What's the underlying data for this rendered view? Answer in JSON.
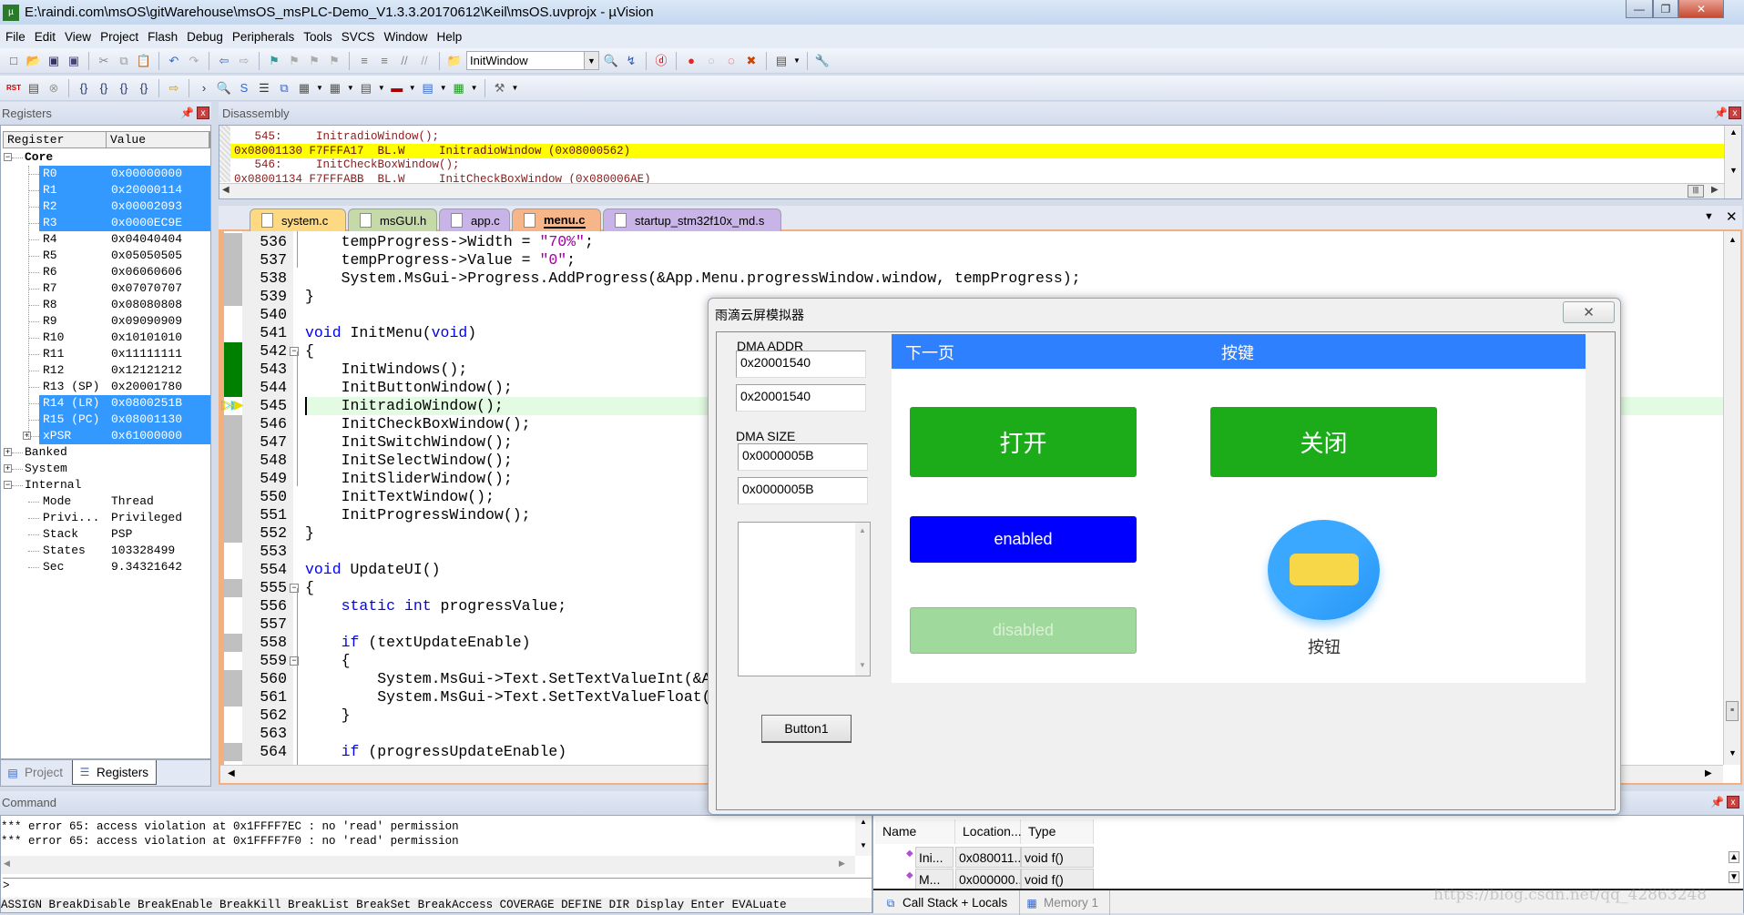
{
  "window": {
    "title": "E:\\raindi.com\\msOS\\gitWarehouse\\msOS_msPLC-Demo_V1.3.3.20170612\\Keil\\msOS.uvprojx - µVision"
  },
  "menu": [
    "File",
    "Edit",
    "View",
    "Project",
    "Flash",
    "Debug",
    "Peripherals",
    "Tools",
    "SVCS",
    "Window",
    "Help"
  ],
  "toolbar1": {
    "icons_before_combo": [
      "new-file",
      "open",
      "save",
      "save-all",
      "|",
      "cut",
      "copy",
      "paste",
      "|",
      "undo",
      "redo",
      "|",
      "nav-back",
      "nav-forward",
      "|",
      "bookmark",
      "prev-bookmark",
      "next-bookmark",
      "clear-bookmarks",
      "|",
      "indent",
      "unindent",
      "comment",
      "uncomment",
      "|",
      "find-in-files"
    ],
    "combo_value": "InitWindow",
    "icons_after_combo": [
      "find",
      "incremental-find",
      "|",
      "debug-session",
      "|",
      "insert-breakpoint",
      "enable-breakpoint",
      "disable-breakpoints",
      "kill-breakpoints",
      "|",
      "window-layout",
      "|",
      "configure"
    ]
  },
  "toolbar2": {
    "icons": [
      "reset",
      "run",
      "stop",
      "|",
      "step",
      "step-over",
      "step-out",
      "run-to-cursor",
      "|",
      "show-next-statement",
      "|",
      "command-window",
      "disassembly-window",
      "symbols-window",
      "registers-window",
      "call-stack-window",
      "watch-window",
      "memory-window",
      "serial-window",
      "analysis-window",
      "trace-window",
      "system-viewer",
      "|",
      "toolbox"
    ]
  },
  "registers": {
    "title": "Registers",
    "col_register": "Register",
    "col_value": "Value",
    "rows": [
      {
        "name": "Core",
        "value": "",
        "level": 0,
        "expander": "minus",
        "bold": true
      },
      {
        "name": "R0",
        "value": "0x00000000",
        "level": 1,
        "selected": true
      },
      {
        "name": "R1",
        "value": "0x20000114",
        "level": 1,
        "selected": true
      },
      {
        "name": "R2",
        "value": "0x00002093",
        "level": 1,
        "selected": true
      },
      {
        "name": "R3",
        "value": "0x0000EC9E",
        "level": 1,
        "selected": true
      },
      {
        "name": "R4",
        "value": "0x04040404",
        "level": 1
      },
      {
        "name": "R5",
        "value": "0x05050505",
        "level": 1
      },
      {
        "name": "R6",
        "value": "0x06060606",
        "level": 1
      },
      {
        "name": "R7",
        "value": "0x07070707",
        "level": 1
      },
      {
        "name": "R8",
        "value": "0x08080808",
        "level": 1
      },
      {
        "name": "R9",
        "value": "0x09090909",
        "level": 1
      },
      {
        "name": "R10",
        "value": "0x10101010",
        "level": 1
      },
      {
        "name": "R11",
        "value": "0x11111111",
        "level": 1
      },
      {
        "name": "R12",
        "value": "0x12121212",
        "level": 1
      },
      {
        "name": "R13 (SP)",
        "value": "0x20001780",
        "level": 1
      },
      {
        "name": "R14 (LR)",
        "value": "0x0800251B",
        "level": 1,
        "selected": true
      },
      {
        "name": "R15 (PC)",
        "value": "0x08001130",
        "level": 1,
        "selected": true
      },
      {
        "name": "xPSR",
        "value": "0x61000000",
        "level": 1,
        "selected": true,
        "expander": "plus"
      },
      {
        "name": "Banked",
        "value": "",
        "level": 0,
        "expander": "plus"
      },
      {
        "name": "System",
        "value": "",
        "level": 0,
        "expander": "plus"
      },
      {
        "name": "Internal",
        "value": "",
        "level": 0,
        "expander": "minus"
      },
      {
        "name": "Mode",
        "value": "Thread",
        "level": 1
      },
      {
        "name": "Privi...",
        "value": "Privileged",
        "level": 1
      },
      {
        "name": "Stack",
        "value": "PSP",
        "level": 1
      },
      {
        "name": "States",
        "value": "103328499",
        "level": 1
      },
      {
        "name": "Sec",
        "value": "9.34321642",
        "level": 1
      }
    ],
    "tabs": [
      {
        "label": "Project",
        "active": false
      },
      {
        "label": "Registers",
        "active": true
      }
    ]
  },
  "disassembly": {
    "title": "Disassembly",
    "lines": [
      {
        "text": "   545:     InitradioWindow();",
        "current": false
      },
      {
        "text": "0x08001130 F7FFFA17  BL.W     InitradioWindow (0x08000562)",
        "current": true
      },
      {
        "text": "   546:     InitCheckBoxWindow();",
        "current": false
      },
      {
        "text": "0x08001134 F7FFFABB  BL.W     InitCheckBoxWindow (0x080006AE)",
        "current": false
      }
    ]
  },
  "file_tabs": [
    {
      "label": "system.c",
      "color": "#fcd982",
      "active": false
    },
    {
      "label": "msGUI.h",
      "color": "#c6d9a8",
      "active": false
    },
    {
      "label": "app.c",
      "color": "#c8b4e6",
      "active": false
    },
    {
      "label": "menu.c",
      "color": "#f7b68a",
      "active": true
    },
    {
      "label": "startup_stm32f10x_md.s",
      "color": "#c8b4e6",
      "active": false
    }
  ],
  "code": {
    "current_line": 545,
    "lines": [
      {
        "n": "536",
        "m": "gray",
        "tok": [
          [
            "    tempProgress->Width = ",
            ""
          ],
          [
            "\"70%\"",
            "str"
          ],
          [
            ";",
            ""
          ]
        ]
      },
      {
        "n": "537",
        "m": "gray",
        "tok": [
          [
            "    tempProgress->Value = ",
            ""
          ],
          [
            "\"0\"",
            "str"
          ],
          [
            ";",
            ""
          ]
        ]
      },
      {
        "n": "538",
        "m": "gray",
        "tok": [
          [
            "    System.MsGui->Progress.AddProgress(&App.Menu.progressWindow.window, tempProgress);",
            ""
          ]
        ]
      },
      {
        "n": "539",
        "m": "gray",
        "tok": [
          [
            "}",
            ""
          ]
        ]
      },
      {
        "n": "540",
        "m": "",
        "tok": []
      },
      {
        "n": "541",
        "m": "",
        "tok": [
          [
            "void",
            "kw"
          ],
          [
            " InitMenu(",
            ""
          ],
          [
            "void",
            "kw"
          ],
          [
            ")",
            ""
          ]
        ]
      },
      {
        "n": "542",
        "m": "green",
        "fold": true,
        "tok": [
          [
            "{",
            ""
          ]
        ]
      },
      {
        "n": "543",
        "m": "green",
        "tok": [
          [
            "    InitWindows();",
            ""
          ]
        ]
      },
      {
        "n": "544",
        "m": "green",
        "tok": [
          [
            "    InitButtonWindow();",
            ""
          ]
        ]
      },
      {
        "n": "545",
        "m": "arrow",
        "tok": [
          [
            "    InitradioWindow();",
            ""
          ]
        ]
      },
      {
        "n": "546",
        "m": "gray",
        "tok": [
          [
            "    InitCheckBoxWindow();",
            ""
          ]
        ]
      },
      {
        "n": "547",
        "m": "gray",
        "tok": [
          [
            "    InitSwitchWindow();",
            ""
          ]
        ]
      },
      {
        "n": "548",
        "m": "gray",
        "tok": [
          [
            "    InitSelectWindow();",
            ""
          ]
        ]
      },
      {
        "n": "549",
        "m": "gray",
        "tok": [
          [
            "    InitSliderWindow();",
            ""
          ]
        ]
      },
      {
        "n": "550",
        "m": "gray",
        "tok": [
          [
            "    InitTextWindow();",
            ""
          ]
        ]
      },
      {
        "n": "551",
        "m": "gray",
        "tok": [
          [
            "    InitProgressWindow();",
            ""
          ]
        ]
      },
      {
        "n": "552",
        "m": "gray",
        "tok": [
          [
            "}",
            ""
          ]
        ]
      },
      {
        "n": "553",
        "m": "",
        "tok": []
      },
      {
        "n": "554",
        "m": "",
        "tok": [
          [
            "void",
            "kw"
          ],
          [
            " UpdateUI()",
            ""
          ]
        ]
      },
      {
        "n": "555",
        "m": "gray",
        "fold": true,
        "tok": [
          [
            "{",
            ""
          ]
        ]
      },
      {
        "n": "556",
        "m": "",
        "tok": [
          [
            "    ",
            ""
          ],
          [
            "static",
            "kw"
          ],
          [
            " ",
            ""
          ],
          [
            "int",
            "kw"
          ],
          [
            " progressValue;",
            ""
          ]
        ]
      },
      {
        "n": "557",
        "m": "",
        "tok": []
      },
      {
        "n": "558",
        "m": "gray",
        "tok": [
          [
            "    ",
            ""
          ],
          [
            "if",
            "kw"
          ],
          [
            " (textUpdateEnable)",
            ""
          ]
        ]
      },
      {
        "n": "559",
        "m": "",
        "fold": true,
        "tok": [
          [
            "    {",
            ""
          ]
        ]
      },
      {
        "n": "560",
        "m": "gray",
        "tok": [
          [
            "        System.MsGui->Text.SetTextValueInt(&A",
            ""
          ]
        ]
      },
      {
        "n": "561",
        "m": "gray",
        "tok": [
          [
            "        System.MsGui->Text.SetTextValueFloat(",
            ""
          ]
        ]
      },
      {
        "n": "562",
        "m": "",
        "tok": [
          [
            "    }",
            ""
          ]
        ]
      },
      {
        "n": "563",
        "m": "",
        "tok": []
      },
      {
        "n": "564",
        "m": "gray",
        "tok": [
          [
            "    ",
            ""
          ],
          [
            "if",
            "kw"
          ],
          [
            " (progressUpdateEnable)",
            ""
          ]
        ]
      }
    ]
  },
  "dialog": {
    "title": "雨滴云屏模拟器",
    "dma_addr_label": "DMA ADDR",
    "dma_addr_1": "0x20001540",
    "dma_addr_2": "0x20001540",
    "dma_size_label": "DMA SIZE",
    "dma_size_1": "0x0000005B",
    "dma_size_2": "0x0000005B",
    "button1": "Button1",
    "screen": {
      "header_left": "下一页",
      "header_title": "按键",
      "btn_open": "打开",
      "btn_close": "关闭",
      "btn_enabled": "enabled",
      "btn_disabled": "disabled",
      "round_button_label": "按钮",
      "colors": {
        "header": "#2f80ff",
        "green": "#1cac1a",
        "blue": "#0000ff",
        "disabled": "#a0d99c",
        "circle": "#3aa8ff",
        "yellow": "#f7d748"
      }
    }
  },
  "command": {
    "title": "Command",
    "output": [
      "*** error 65: access violation at 0x1FFFF7EC : no 'read' permission",
      "*** error 65: access violation at 0x1FFFF7F0 : no 'read' permission"
    ],
    "prompt": ">",
    "hints": "ASSIGN BreakDisable BreakEnable BreakKill BreakList BreakSet BreakAccess COVERAGE DEFINE DIR Display Enter EVALuate"
  },
  "callstack": {
    "columns": [
      "Name",
      "Location...",
      "Type"
    ],
    "rows": [
      [
        "Ini...",
        "0x080011...",
        "void f()"
      ],
      [
        "M...",
        "0x000000...",
        "void f()"
      ]
    ],
    "tabs": [
      {
        "label": "Call Stack + Locals",
        "active": true
      },
      {
        "label": "Memory 1",
        "active": false
      }
    ]
  },
  "watermark": "https://blog.csdn.net/qq_42863248"
}
